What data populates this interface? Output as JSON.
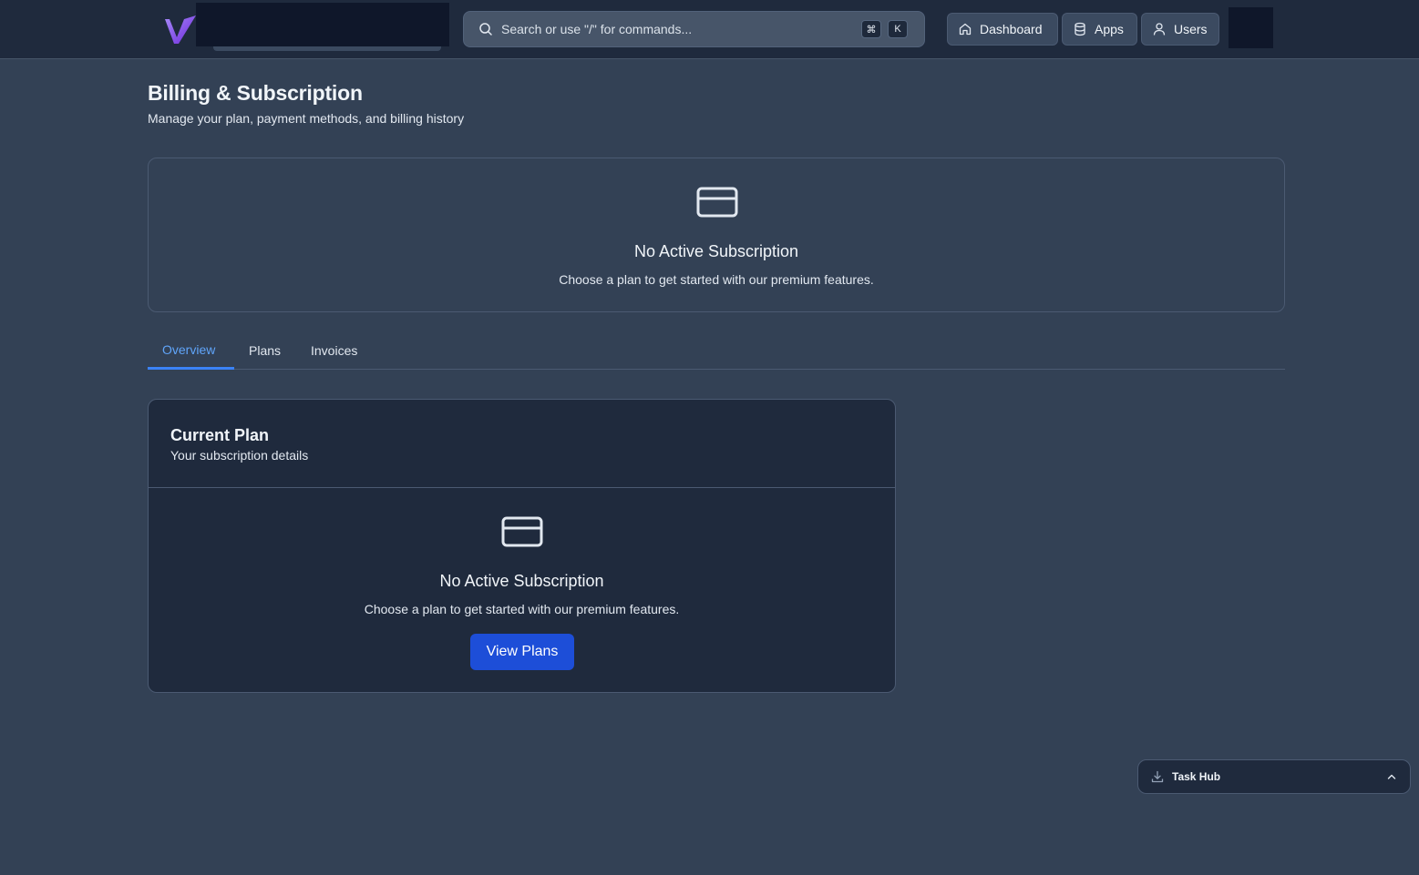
{
  "search": {
    "placeholder": "Search or use \"/\" for commands...",
    "kbd_modifier": "⌘",
    "kbd_key": "K"
  },
  "nav": {
    "dashboard": "Dashboard",
    "apps": "Apps",
    "users": "Users"
  },
  "header": {
    "title": "Billing & Subscription",
    "subtitle": "Manage your plan, payment methods, and billing history"
  },
  "banner": {
    "icon": "credit-card-icon",
    "title": "No Active Subscription",
    "text": "Choose a plan to get started with our premium features."
  },
  "tabs": [
    {
      "label": "Overview",
      "active": true
    },
    {
      "label": "Plans",
      "active": false
    },
    {
      "label": "Invoices",
      "active": false
    }
  ],
  "current_plan": {
    "title": "Current Plan",
    "subtitle": "Your subscription details",
    "empty_icon": "credit-card-icon",
    "empty_title": "No Active Subscription",
    "empty_text": "Choose a plan to get started with our premium features.",
    "button_label": "View Plans"
  },
  "task_hub": {
    "label": "Task Hub",
    "icon": "download-icon",
    "toggle_icon": "chevron-up-icon"
  },
  "colors": {
    "background": "#334155",
    "topbar": "#1f2a3d",
    "card": "#1f2a3d",
    "accent": "#60a5fa",
    "primary_button": "#1d4ed8"
  }
}
